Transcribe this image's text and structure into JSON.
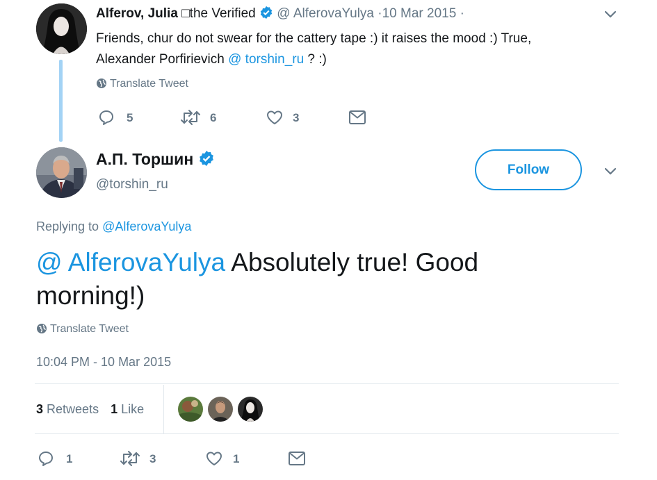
{
  "parent_tweet": {
    "name": "Alferov, Julia",
    "verified_text": "□the Verified",
    "handle": "@ AlferovaYulya",
    "date": "·10 Mar 2015 ·",
    "text_line1": "Friends, chur do not swear for the cattery tape :) it raises the mood :) True,",
    "text_line2_prefix": "Alexander Porfirievich ",
    "text_mention": "@ torshin_ru",
    "text_line2_suffix": " ? :)",
    "translate": "Translate Tweet",
    "replies": "5",
    "retweets": "6",
    "likes": "3"
  },
  "main_tweet": {
    "name": "А.П. Торшин",
    "handle": "@torshin_ru",
    "follow_label": "Follow",
    "replying_prefix": "Replying to ",
    "replying_handle": "@AlferovaYulya",
    "mention": "@ AlferovaYulya",
    "text_rest": " Absolutely true! Good",
    "text_line2": "morning!)",
    "translate": "Translate Tweet",
    "timestamp": "10:04 PM - 10 Mar 2015",
    "stats": {
      "retweet_count": "3",
      "retweet_label": "Retweets",
      "like_count": "1",
      "like_label": "Like"
    },
    "replies": "1",
    "retweets": "3",
    "likes": "1"
  },
  "colors": {
    "accent": "#1b95e0",
    "muted": "#657786",
    "thread_line": "#a3d3f5"
  },
  "icons": [
    "chevron-down-icon",
    "verified-badge-icon",
    "globe-icon",
    "reply-icon",
    "retweet-icon",
    "like-icon",
    "direct-message-icon"
  ]
}
